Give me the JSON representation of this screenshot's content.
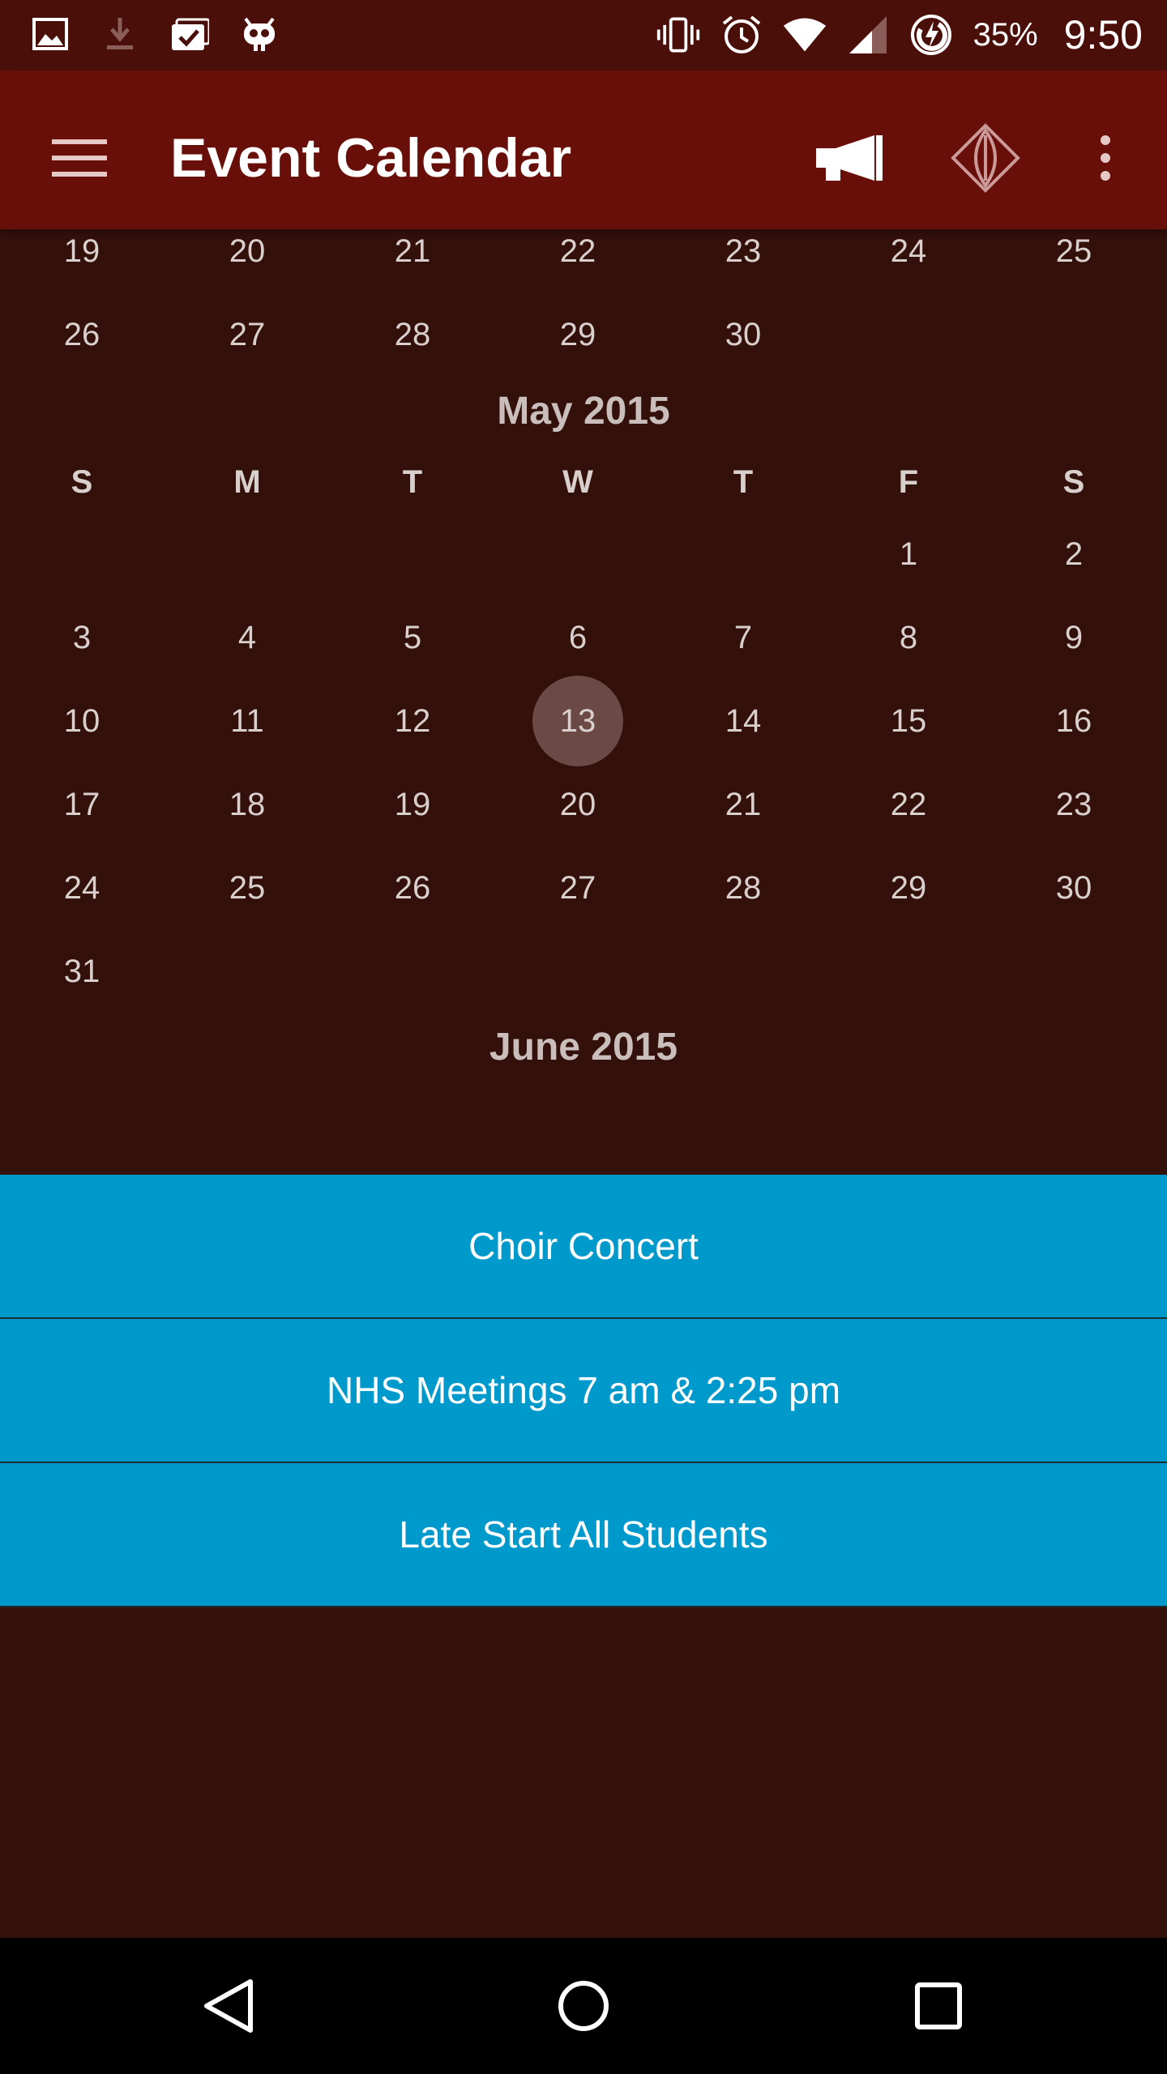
{
  "status_bar": {
    "icons_left": [
      "image-icon",
      "download-icon",
      "clipboard-check-icon",
      "android-bot-icon"
    ],
    "icons_right": [
      "vibrate-icon",
      "alarm-icon",
      "wifi-icon",
      "cell-signal-icon",
      "battery-charging-icon"
    ],
    "battery": "35%",
    "time": "9:50"
  },
  "app_bar": {
    "title": "Event Calendar",
    "background": "#690f0a",
    "actions": [
      "menu-icon",
      "megaphone-icon",
      "diamond-logo-icon",
      "more-vert-icon"
    ]
  },
  "calendar": {
    "weekday_headers": [
      "S",
      "M",
      "T",
      "W",
      "T",
      "F",
      "S"
    ],
    "april_tail": {
      "rows": [
        [
          "19",
          "20",
          "21",
          "22",
          "23",
          "24",
          "25"
        ],
        [
          "26",
          "27",
          "28",
          "29",
          "30",
          "",
          ""
        ]
      ]
    },
    "may": {
      "label": "May 2015",
      "rows": [
        [
          "",
          "",
          "",
          "",
          "",
          "1",
          "2"
        ],
        [
          "3",
          "4",
          "5",
          "6",
          "7",
          "8",
          "9"
        ],
        [
          "10",
          "11",
          "12",
          "13",
          "14",
          "15",
          "16"
        ],
        [
          "17",
          "18",
          "19",
          "20",
          "21",
          "22",
          "23"
        ],
        [
          "24",
          "25",
          "26",
          "27",
          "28",
          "29",
          "30"
        ],
        [
          "31",
          "",
          "",
          "",
          "",
          "",
          ""
        ]
      ],
      "selected": "13"
    },
    "june": {
      "label": "June 2015"
    }
  },
  "events": {
    "background": "#0099cc",
    "items": [
      {
        "title": "Choir Concert"
      },
      {
        "title": "NHS Meetings 7 am & 2:25 pm"
      },
      {
        "title": "Late Start All Students"
      }
    ]
  },
  "nav_bar": {
    "buttons": [
      "back-icon",
      "home-icon",
      "recents-icon"
    ]
  }
}
